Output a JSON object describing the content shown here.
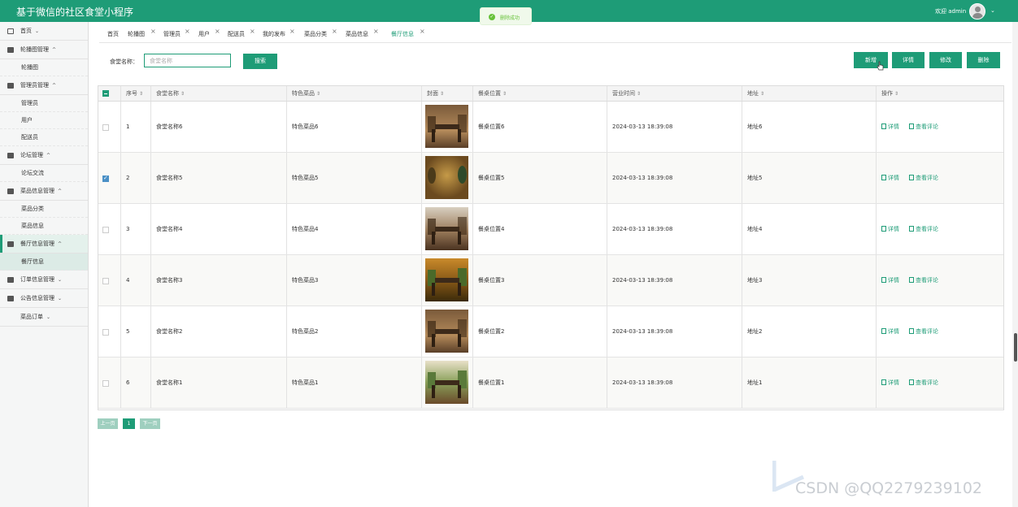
{
  "app": {
    "title": "基于微信的社区食堂小程序",
    "welcome": "欢迎 admin"
  },
  "toast": {
    "message": "删除成功"
  },
  "sidebar": {
    "items": [
      {
        "label": "首页",
        "chev": "⌄"
      },
      {
        "label": "轮播图管理",
        "chev": "^",
        "subs": [
          "轮播图"
        ]
      },
      {
        "label": "管理员管理",
        "chev": "^",
        "subs": [
          "管理员",
          "用户",
          "配送员"
        ]
      },
      {
        "label": "论坛管理",
        "chev": "^",
        "subs": [
          "论坛交流"
        ]
      },
      {
        "label": "菜品信息管理",
        "chev": "^",
        "subs": [
          "菜品分类",
          "菜品信息"
        ]
      },
      {
        "label": "餐厅信息管理",
        "chev": "^",
        "subs": [
          "餐厅信息"
        ]
      },
      {
        "label": "订单信息管理",
        "chev": "⌄"
      },
      {
        "label": "公告信息管理",
        "chev": "⌄"
      },
      {
        "label": "菜品订单",
        "chev": "⌄"
      }
    ]
  },
  "tabs": [
    "首页",
    "轮播图",
    "管理员",
    "用户",
    "配送员",
    "我的发布",
    "菜品分类",
    "菜品信息",
    "餐厅信息"
  ],
  "search": {
    "label": "食堂名称：",
    "placeholder": "食堂名称",
    "button": "搜索"
  },
  "actions": {
    "add": "新增",
    "detail": "详情",
    "edit": "修改",
    "delete": "删除"
  },
  "table": {
    "columns": [
      "序号",
      "食堂名称",
      "特色菜品",
      "封面",
      "餐桌位置",
      "营业时间",
      "地址",
      "操作"
    ],
    "rows": [
      {
        "no": "1",
        "name": "食堂名称6",
        "dish": "特色菜品6",
        "seat": "餐桌位置6",
        "time": "2024-03-13 18:39:08",
        "addr": "地址6",
        "checked": false
      },
      {
        "no": "2",
        "name": "食堂名称5",
        "dish": "特色菜品5",
        "seat": "餐桌位置5",
        "time": "2024-03-13 18:39:08",
        "addr": "地址5",
        "checked": true
      },
      {
        "no": "3",
        "name": "食堂名称4",
        "dish": "特色菜品4",
        "seat": "餐桌位置4",
        "time": "2024-03-13 18:39:08",
        "addr": "地址4",
        "checked": false
      },
      {
        "no": "4",
        "name": "食堂名称3",
        "dish": "特色菜品3",
        "seat": "餐桌位置3",
        "time": "2024-03-13 18:39:08",
        "addr": "地址3",
        "checked": false
      },
      {
        "no": "5",
        "name": "食堂名称2",
        "dish": "特色菜品2",
        "seat": "餐桌位置2",
        "time": "2024-03-13 18:39:08",
        "addr": "地址2",
        "checked": false
      },
      {
        "no": "6",
        "name": "食堂名称1",
        "dish": "特色菜品1",
        "seat": "餐桌位置1",
        "time": "2024-03-13 18:39:08",
        "addr": "地址1",
        "checked": false
      }
    ],
    "row_actions": {
      "detail": "详情",
      "comments": "查看评论"
    }
  },
  "pager": {
    "prev": "上一页",
    "page": "1",
    "next": "下一页"
  },
  "watermark": "CSDN @QQ2279239102",
  "colors": {
    "primary": "#1e9c77",
    "toast": "#67c23a"
  }
}
